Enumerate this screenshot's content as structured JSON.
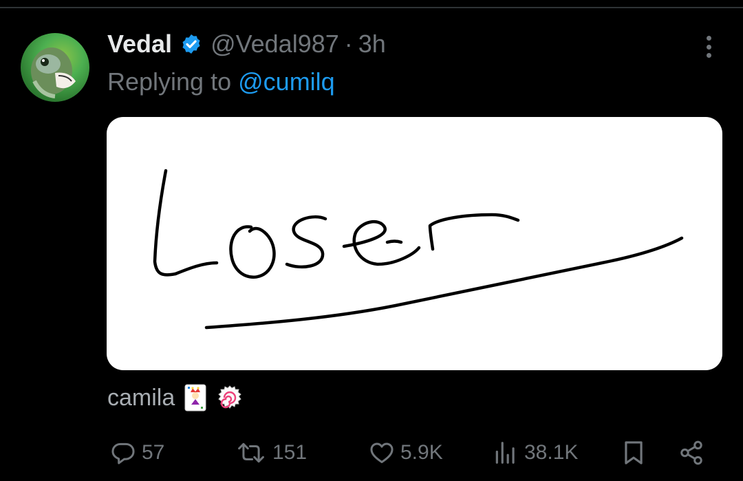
{
  "tweet": {
    "display_name": "Vedal",
    "verified": true,
    "handle": "@Vedal987",
    "separator": "·",
    "time": "3h",
    "replying_prefix": "Replying to",
    "replying_to": "@cumilq",
    "media_handwritten_text": "Loser",
    "caption_name": "camila",
    "caption_emojis": [
      "joker-card-emoji",
      "fish-cake-swirl-emoji"
    ]
  },
  "actions": {
    "replies": "57",
    "reposts": "151",
    "likes": "5.9K",
    "views": "38.1K"
  },
  "icons": [
    "more-vertical-icon",
    "verified-badge-icon",
    "reply-icon",
    "repost-icon",
    "like-icon",
    "views-icon",
    "bookmark-icon",
    "share-icon"
  ],
  "colors": {
    "background": "#000000",
    "primary_text": "#e7e9ea",
    "secondary_text": "#71767b",
    "accent": "#1d9bf0"
  }
}
